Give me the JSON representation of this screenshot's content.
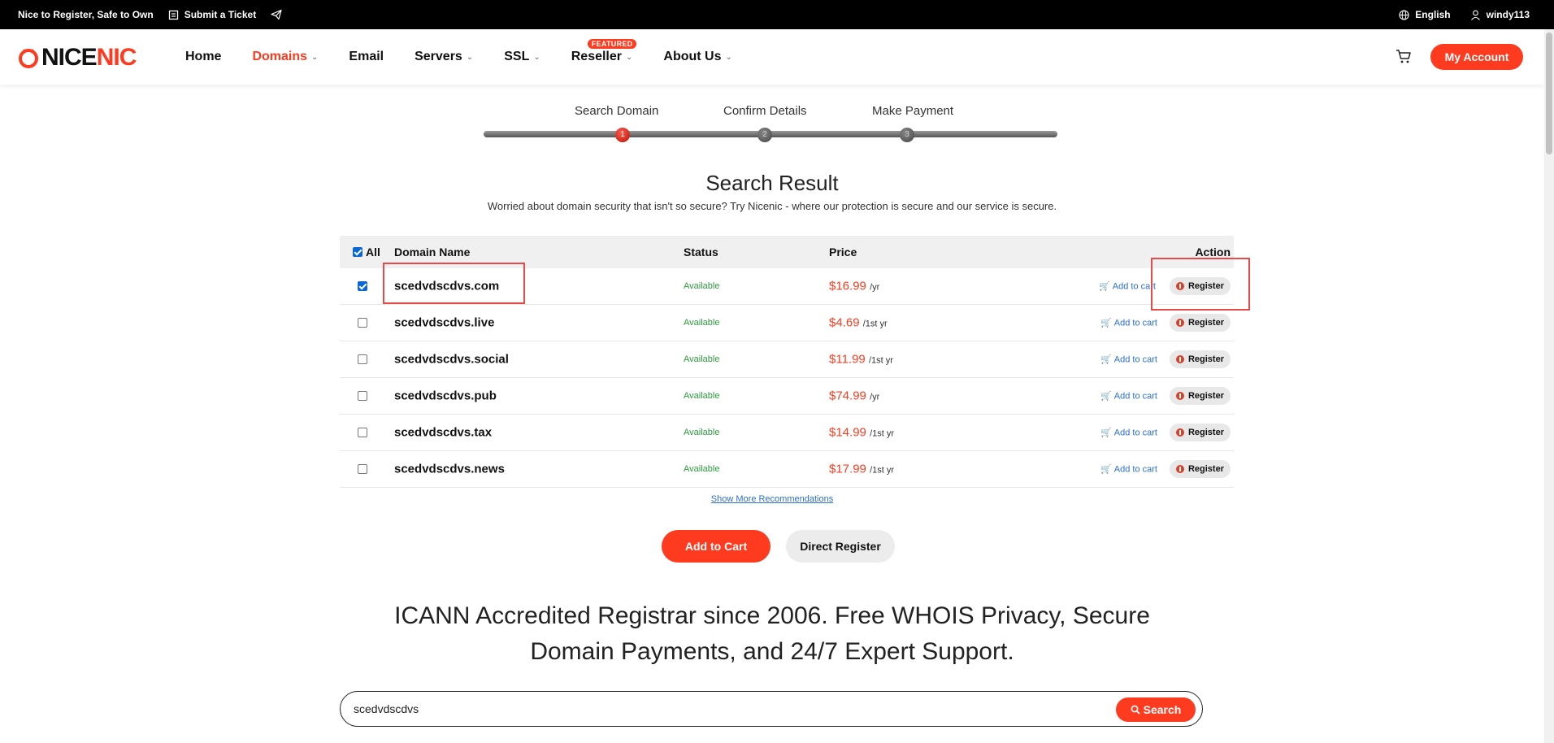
{
  "topbar": {
    "slogan": "Nice to Register, Safe to Own",
    "ticket_label": "Submit a Ticket",
    "language": "English",
    "username": "windy113"
  },
  "nav": {
    "logo_part1": "NICE",
    "logo_part2": "NIC",
    "items": [
      {
        "label": "Home",
        "dropdown": false
      },
      {
        "label": "Domains",
        "dropdown": true,
        "active": true
      },
      {
        "label": "Email",
        "dropdown": false
      },
      {
        "label": "Servers",
        "dropdown": true
      },
      {
        "label": "SSL",
        "dropdown": true
      },
      {
        "label": "Reseller",
        "dropdown": true,
        "badge": "FEATURED"
      },
      {
        "label": "About Us",
        "dropdown": true
      }
    ],
    "account_label": "My Account"
  },
  "steps": {
    "labels": [
      "Search Domain",
      "Confirm Details",
      "Make Payment"
    ],
    "numbers": [
      "1",
      "2",
      "3"
    ],
    "current": 1
  },
  "result": {
    "title": "Search Result",
    "subtitle": "Worried about domain security that isn't so secure? Try Nicenic - where our protection is secure and our service is secure."
  },
  "table": {
    "headers": {
      "all": "All",
      "name": "Domain Name",
      "status": "Status",
      "price": "Price",
      "action": "Action"
    },
    "add_to_cart": "Add to cart",
    "register": "Register",
    "rows": [
      {
        "domain": "scedvdscdvs.com",
        "status": "Available",
        "price": "$16.99",
        "unit": "/yr",
        "checked": true
      },
      {
        "domain": "scedvdscdvs.live",
        "status": "Available",
        "price": "$4.69",
        "unit": "/1st yr",
        "checked": false
      },
      {
        "domain": "scedvdscdvs.social",
        "status": "Available",
        "price": "$11.99",
        "unit": "/1st yr",
        "checked": false
      },
      {
        "domain": "scedvdscdvs.pub",
        "status": "Available",
        "price": "$74.99",
        "unit": "/yr",
        "checked": false
      },
      {
        "domain": "scedvdscdvs.tax",
        "status": "Available",
        "price": "$14.99",
        "unit": "/1st yr",
        "checked": false
      },
      {
        "domain": "scedvdscdvs.news",
        "status": "Available",
        "price": "$17.99",
        "unit": "/1st yr",
        "checked": false
      }
    ]
  },
  "show_more": "Show More Recommendations",
  "actions": {
    "add_to_cart": "Add to Cart",
    "direct_register": "Direct Register"
  },
  "tagline": {
    "line1": "ICANN Accredited Registrar since 2006. Free WHOIS Privacy, Secure",
    "line2": "Domain Payments, and 24/7 Expert Support."
  },
  "search": {
    "value": "scedvdscdvs",
    "button": "Search"
  },
  "colors": {
    "brand": "#ff3b1f",
    "available": "#2a9d3a",
    "link": "#2a6fcf"
  }
}
